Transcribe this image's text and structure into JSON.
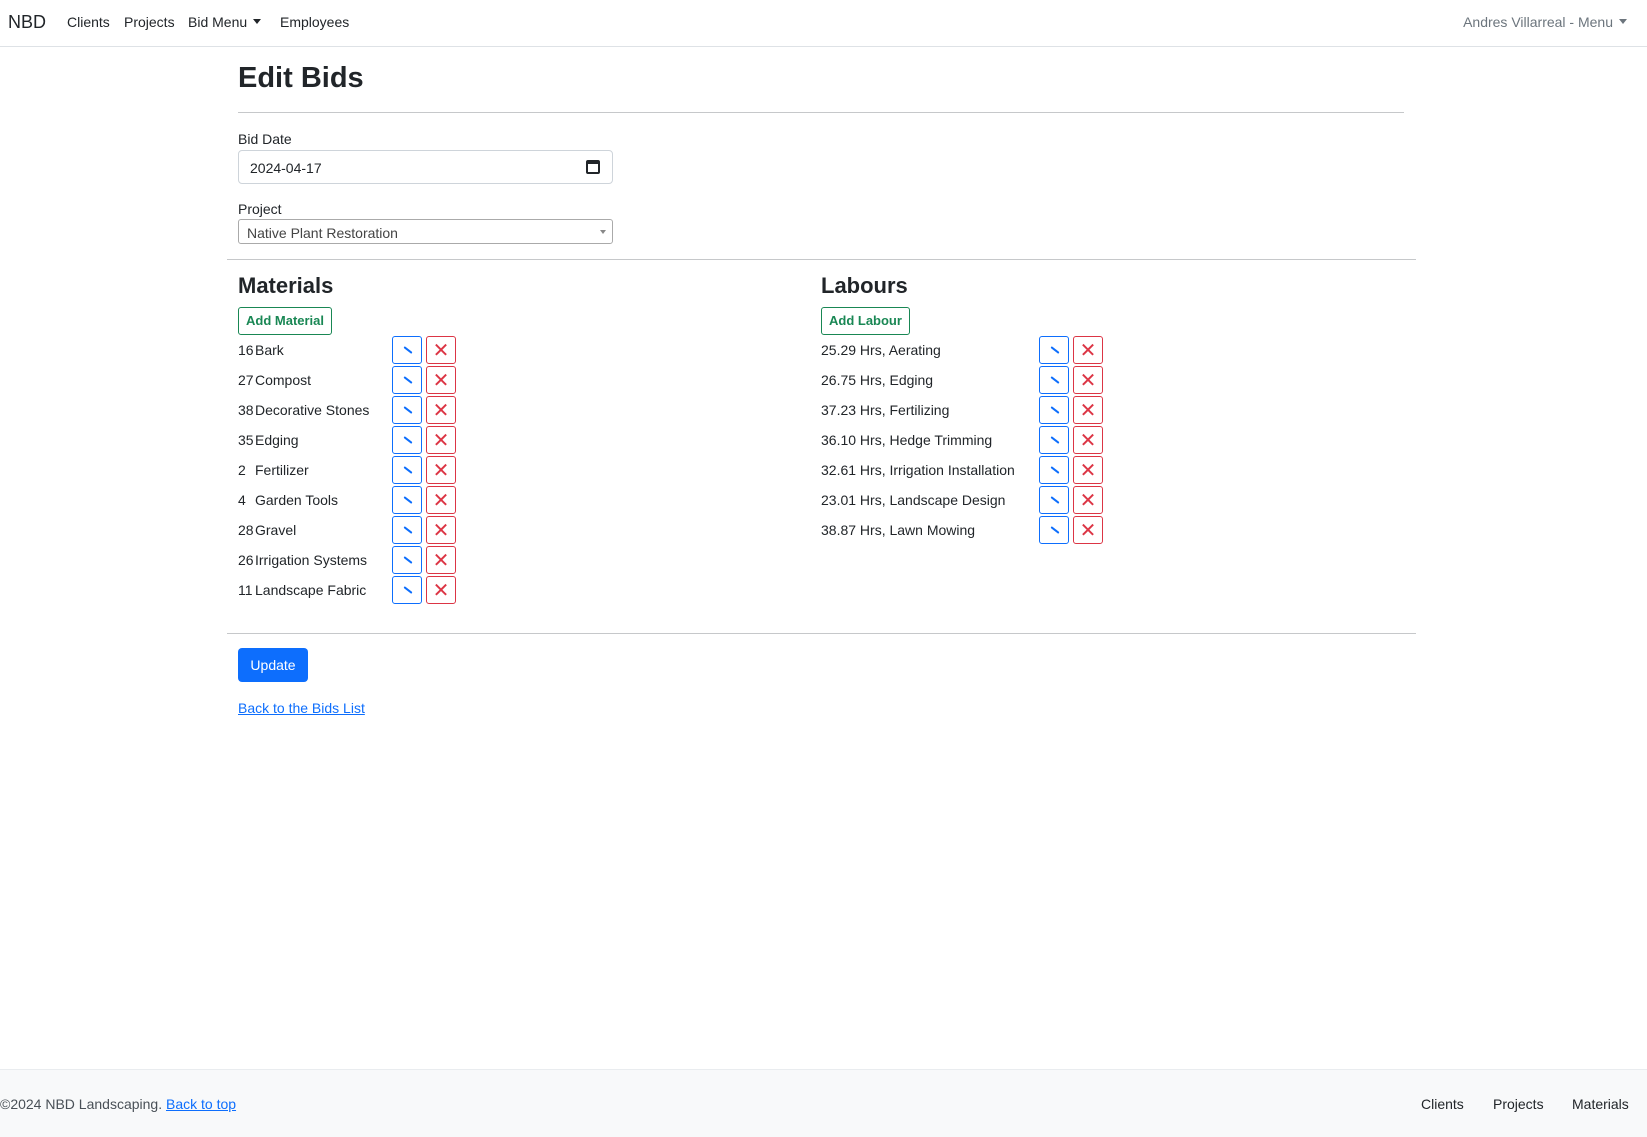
{
  "navbar": {
    "brand": "NBD",
    "items": [
      "Clients",
      "Projects",
      "Bid Menu",
      "Employees"
    ],
    "user_menu": "Andres Villarreal - Menu"
  },
  "page": {
    "title": "Edit Bids",
    "bid_date_label": "Bid Date",
    "bid_date_value": "2024-04-17",
    "project_label": "Project",
    "project_value": "Native Plant Restoration"
  },
  "materials": {
    "title": "Materials",
    "add_label": "Add Material",
    "rows": [
      {
        "qty": "16",
        "name": "Bark"
      },
      {
        "qty": "27",
        "name": "Compost"
      },
      {
        "qty": "38",
        "name": "Decorative Stones"
      },
      {
        "qty": "35",
        "name": "Edging"
      },
      {
        "qty": "2",
        "name": "Fertilizer"
      },
      {
        "qty": "4",
        "name": "Garden Tools"
      },
      {
        "qty": "28",
        "name": "Gravel"
      },
      {
        "qty": "26",
        "name": "Irrigation Systems"
      },
      {
        "qty": "11",
        "name": "Landscape Fabric"
      }
    ]
  },
  "labours": {
    "title": "Labours",
    "add_label": "Add Labour",
    "rows": [
      "25.29 Hrs, Aerating",
      "26.75 Hrs, Edging",
      "37.23 Hrs, Fertilizing",
      "36.10 Hrs, Hedge Trimming",
      "32.61 Hrs, Irrigation Installation",
      "23.01 Hrs, Landscape Design",
      "38.87 Hrs, Lawn Mowing"
    ]
  },
  "actions": {
    "update_label": "Update",
    "back_label": "Back to the Bids List"
  },
  "footer": {
    "copyright": "©2024 NBD Landscaping.",
    "back_to_top": "Back to top",
    "links": [
      "Clients",
      "Projects",
      "Materials"
    ]
  },
  "colors": {
    "primary": "#0d6efd",
    "success": "#198754",
    "danger": "#dc3545"
  }
}
